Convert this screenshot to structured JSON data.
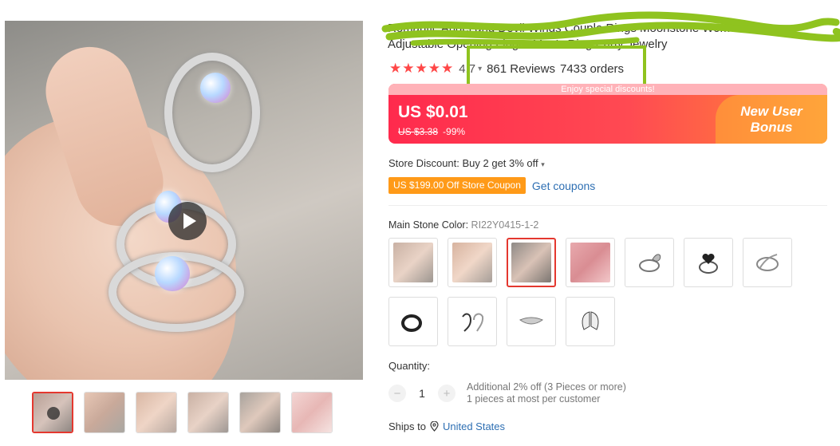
{
  "product": {
    "title_lines": [
      "Romantic Angel and Devil Wings Couple Rings Moonstone Women Men",
      "Adjustable Opening Finger Men's Ring Party Jewelry"
    ],
    "rating": "4.7",
    "reviews": "861 Reviews",
    "orders": "7433 orders",
    "stars": "★★★★★"
  },
  "price": {
    "banner_note": "Enjoy special discounts!",
    "current": "US $0.01",
    "original": "US $3.38",
    "discount": "-99%",
    "bonus_line1": "New User",
    "bonus_line2": "Bonus"
  },
  "store": {
    "discount": "Store Discount: Buy 2 get 3% off",
    "coupon": "US $199.00 Off Store Coupon",
    "get_coupons": "Get coupons"
  },
  "variant": {
    "label": "Main Stone Color:",
    "value": "RI22Y0415-1-2",
    "swatches": [
      "photo-1",
      "photo-2",
      "photo-3",
      "photo-4",
      "wing-ring",
      "heart-ring",
      "wrap-ring",
      "black-ring",
      "devil-heart",
      "plain-band",
      "wings"
    ],
    "selected_index": 2
  },
  "quantity": {
    "label": "Quantity:",
    "value": "1",
    "note_line1": "Additional 2% off (3 Pieces or more)",
    "note_line2": "1 pieces at most per customer",
    "minus": "−",
    "plus": "+"
  },
  "shipping": {
    "label": "Ships to",
    "country": "United States"
  },
  "gallery": {
    "thumb_count": 6,
    "active_index": 0
  },
  "colors": {
    "star": "#ff4747",
    "price_gradient_start": "#ff2a4d",
    "accent_link": "#2e6fb3",
    "coupon": "#ff9a18",
    "highlight": "#8fc31f",
    "scribble": "#8fc31f"
  }
}
